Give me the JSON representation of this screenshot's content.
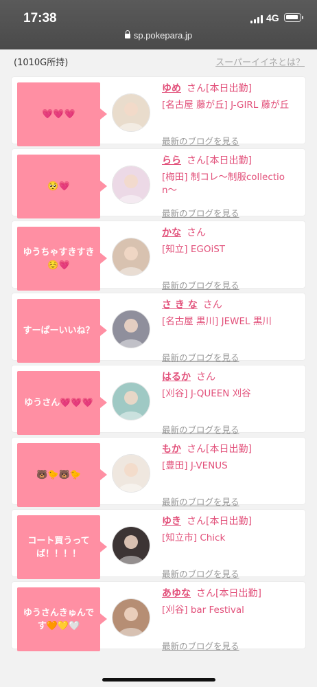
{
  "status_bar": {
    "time": "17:38",
    "network": "4G"
  },
  "browser": {
    "url": "sp.pokepara.jp"
  },
  "header": {
    "points": "(1010G所持)",
    "help_link": "スーパーイイネとは？"
  },
  "colors": {
    "accent": "#e2507a",
    "bubble": "#ff8fa3",
    "link_gray": "#999999"
  },
  "blog_link": "最新のブログを見る",
  "items": [
    {
      "message": "💗💗💗",
      "name": "ゆめ",
      "suffix": "さん[本日出勤]",
      "store": "[名古屋 藤が丘] J-GIRL 藤が丘",
      "avatar_color": "#e9dccc"
    },
    {
      "message": "🥺💗",
      "name": "らら",
      "suffix": "さん[本日出勤]",
      "store": "[梅田] 制コレ〜制服collection〜",
      "avatar_color": "#ecd9e6"
    },
    {
      "message": "ゆうちゃすきすき☺️💗",
      "name": "かな",
      "suffix": "さん",
      "store": "[知立] EGOiST",
      "avatar_color": "#d8c2b0"
    },
    {
      "message": "すーぱーいいね？",
      "name": "さ き な",
      "suffix": "さん",
      "store": "[名古屋 黒川] JEWEL 黒川",
      "avatar_color": "#8f8f9c"
    },
    {
      "message": "ゆうさん💗💗💗",
      "name": "はるか",
      "suffix": "さん",
      "store": "[刈谷] J-QUEEN 刈谷",
      "avatar_color": "#9fc9c4"
    },
    {
      "message": "🐻🐤🐻🐤",
      "name": "もか",
      "suffix": "さん[本日出勤]",
      "store": "[豊田] J-VENUS",
      "avatar_color": "#efe7df"
    },
    {
      "message": "コート買うってば！！！！",
      "name": "ゆき",
      "suffix": "さん[本日出勤]",
      "store": "[知立市] Chick",
      "avatar_color": "#3c3434"
    },
    {
      "message": "ゆうさんきゅんです🧡💛🤍",
      "name": "あゆな",
      "suffix": "さん[本日出勤]",
      "store": "[刈谷] bar Festival",
      "avatar_color": "#b68e74"
    }
  ]
}
